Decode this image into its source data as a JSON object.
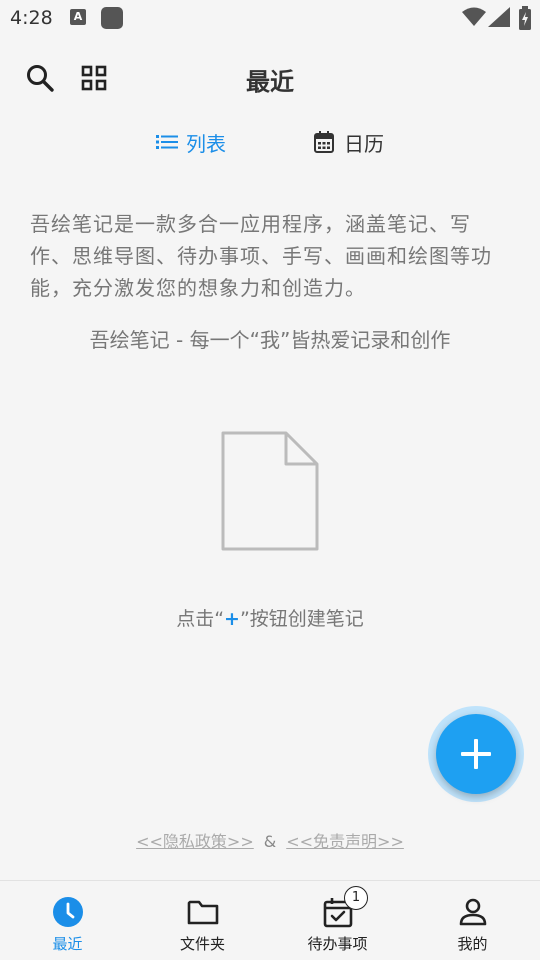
{
  "status_bar": {
    "time": "4:28",
    "notif_letter": "A"
  },
  "app_bar": {
    "title": "最近",
    "icons": [
      "search-icon",
      "grid-icon"
    ]
  },
  "view_toggle": {
    "list_label": "列表",
    "calendar_label": "日历",
    "active": "list"
  },
  "intro": {
    "description": "吾绘笔记是一款多合一应用程序，涵盖笔记、写作、思维导图、待办事项、手写、画画和绘图等功能，充分激发您的想象力和创造力。",
    "slogan": "吾绘笔记 - 每一个“我”皆热爱记录和创作"
  },
  "empty_state": {
    "hint_before": "点击“",
    "hint_plus": "+",
    "hint_after": "”按钮创建笔记"
  },
  "footer_links": {
    "privacy": "<<隐私政策>>",
    "separator": "&",
    "disclaimer": "<<免责声明>>"
  },
  "bottom_nav": {
    "items": [
      {
        "label": "最近",
        "icon": "clock-icon",
        "active": true
      },
      {
        "label": "文件夹",
        "icon": "folder-icon",
        "active": false
      },
      {
        "label": "待办事项",
        "icon": "calendar-check-icon",
        "active": false,
        "badge": "1"
      },
      {
        "label": "我的",
        "icon": "person-icon",
        "active": false
      }
    ]
  },
  "colors": {
    "accent": "#1b8ee8",
    "fab": "#1ea0f2",
    "background": "#f5f5f5",
    "muted_text": "#777777"
  }
}
